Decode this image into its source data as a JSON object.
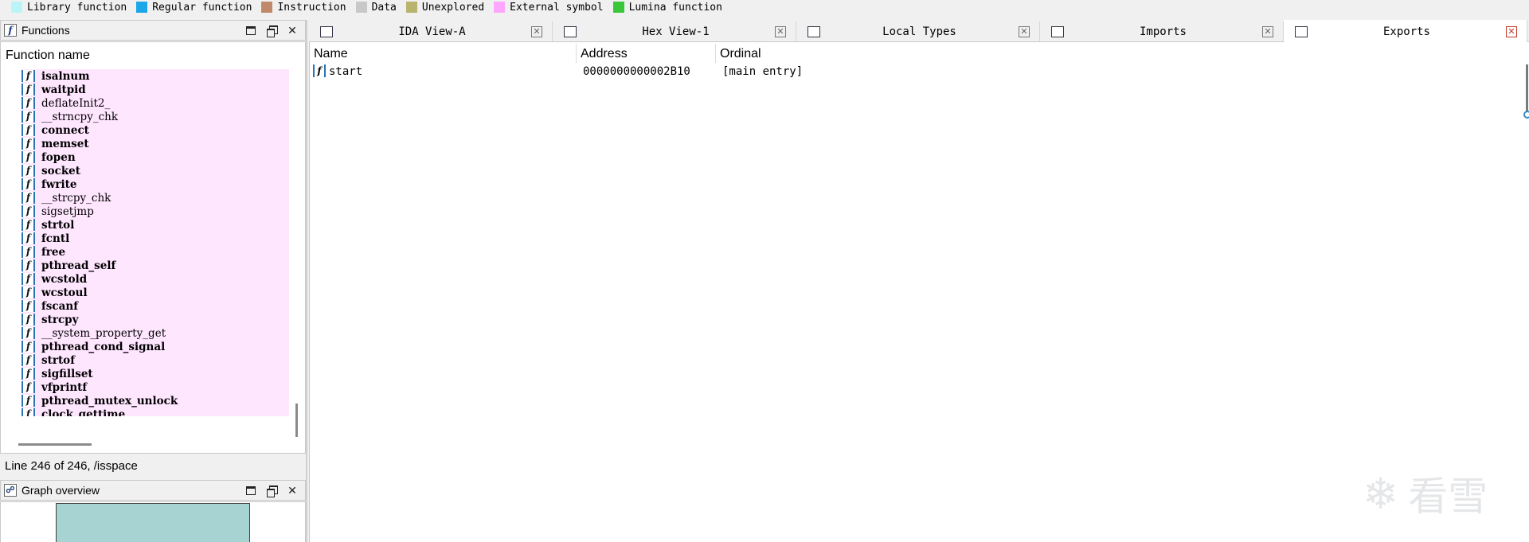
{
  "legend": [
    {
      "label": "Library function",
      "color": "#b9f5f8"
    },
    {
      "label": "Regular function",
      "color": "#1aa6e8"
    },
    {
      "label": "Instruction",
      "color": "#c08a6a"
    },
    {
      "label": "Data",
      "color": "#c8c8c8"
    },
    {
      "label": "Unexplored",
      "color": "#b8b36e"
    },
    {
      "label": "External symbol",
      "color": "#ffa6ff"
    },
    {
      "label": "Lumina function",
      "color": "#39c739"
    }
  ],
  "functions_panel": {
    "title": "Functions",
    "column_header": "Function name",
    "items": [
      {
        "name": "isalnum",
        "bold": true
      },
      {
        "name": "waitpid",
        "bold": true
      },
      {
        "name": "deflateInit2_",
        "bold": false
      },
      {
        "name": "__strncpy_chk",
        "bold": false
      },
      {
        "name": "connect",
        "bold": true
      },
      {
        "name": "memset",
        "bold": true
      },
      {
        "name": "fopen",
        "bold": true
      },
      {
        "name": "socket",
        "bold": true
      },
      {
        "name": "fwrite",
        "bold": true
      },
      {
        "name": "__strcpy_chk",
        "bold": false
      },
      {
        "name": "sigsetjmp",
        "bold": false
      },
      {
        "name": "strtol",
        "bold": true
      },
      {
        "name": "fcntl",
        "bold": true
      },
      {
        "name": "free",
        "bold": true
      },
      {
        "name": "pthread_self",
        "bold": true
      },
      {
        "name": "wcstold",
        "bold": true
      },
      {
        "name": "wcstoul",
        "bold": true
      },
      {
        "name": "fscanf",
        "bold": true
      },
      {
        "name": "strcpy",
        "bold": true
      },
      {
        "name": "__system_property_get",
        "bold": false
      },
      {
        "name": "pthread_cond_signal",
        "bold": true
      },
      {
        "name": "strtof",
        "bold": true
      },
      {
        "name": "sigfillset",
        "bold": true
      },
      {
        "name": "vfprintf",
        "bold": true
      },
      {
        "name": "pthread_mutex_unlock",
        "bold": true
      },
      {
        "name": "clock_gettime",
        "bold": true
      }
    ],
    "status": "Line 246 of 246, /isspace"
  },
  "graph_overview": {
    "title": "Graph overview"
  },
  "tabs": [
    {
      "label": "IDA View-A",
      "active": false
    },
    {
      "label": "Hex View-1",
      "active": false
    },
    {
      "label": "Local Types",
      "active": false
    },
    {
      "label": "Imports",
      "active": false
    },
    {
      "label": "Exports",
      "active": true
    }
  ],
  "exports": {
    "columns": [
      "Name",
      "Address",
      "Ordinal"
    ],
    "rows": [
      {
        "name": "start",
        "address": "0000000000002B10",
        "ordinal": "[main entry]"
      }
    ]
  },
  "watermark": {
    "text": "看雪",
    "icon": "snowflake-icon"
  }
}
